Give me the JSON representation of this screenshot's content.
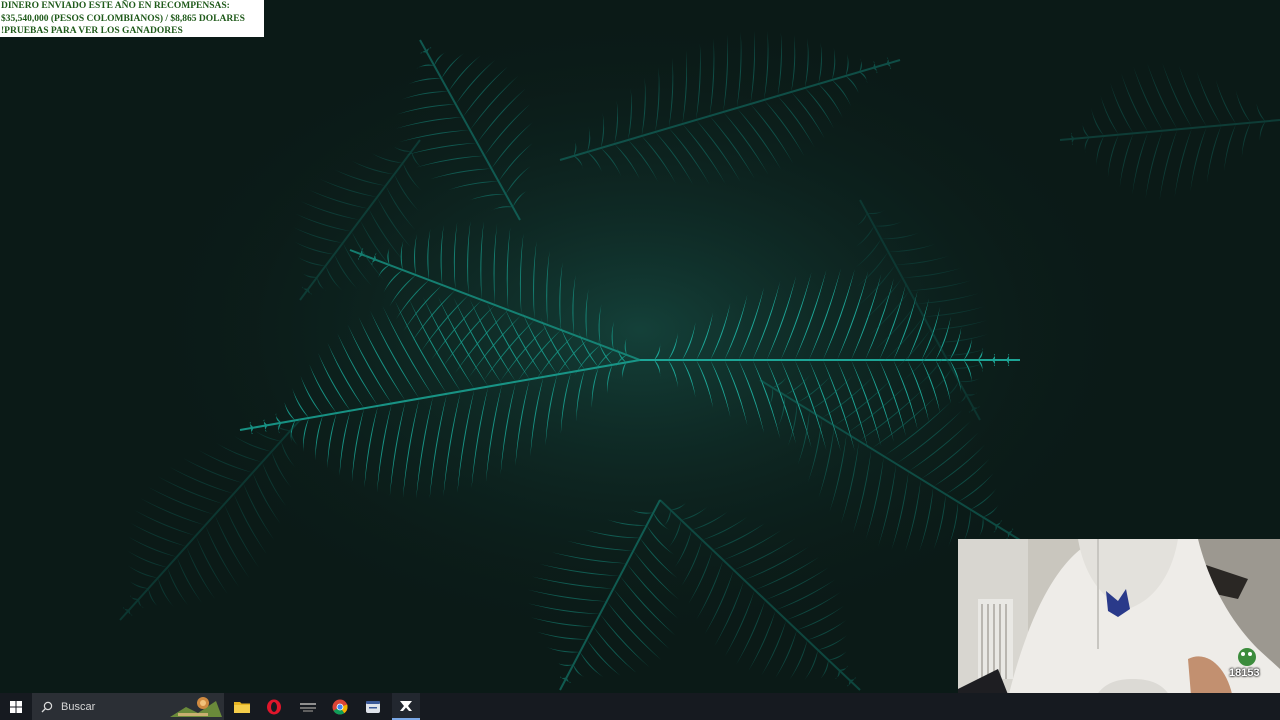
{
  "overlay_banner": {
    "line1": "DINERO ENVIADO ESTE AÑO EN RECOMPENSAS:",
    "line2": " $35,540,000 (PESOS COLOMBIANOS) / $8,865 DOLARES",
    "line3": "!PRUEBAS PARA VER LOS GANADORES"
  },
  "taskbar": {
    "search_placeholder": "Buscar",
    "pinned_apps": [
      "start-icon",
      "search-icon",
      "file-explorer-icon",
      "opera-icon",
      "app-icon",
      "chrome-icon",
      "app-window-icon",
      "app-x-icon"
    ]
  },
  "webcam": {
    "badge_text": "18153"
  },
  "colors": {
    "taskbar": "#161a20",
    "search_box": "#2b2f35",
    "fern": "#1fb3a3",
    "banner_text": "#1f5a1a"
  }
}
